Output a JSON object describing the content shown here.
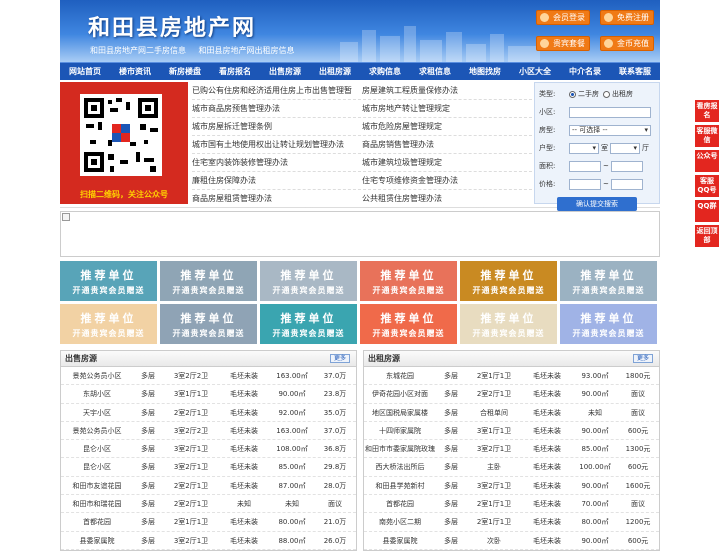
{
  "header": {
    "title": "和田县房地产网",
    "subtitle_1": "和田县房地产网二手房信息",
    "subtitle_2": "和田县房地产网出租房信息",
    "buttons": [
      "会员登录",
      "免费注册",
      "贵宾套餐",
      "金币充值"
    ]
  },
  "nav": [
    "网站首页",
    "楼市资讯",
    "新房楼盘",
    "看房报名",
    "出售房源",
    "出租房源",
    "求购信息",
    "求租信息",
    "地图找房",
    "小区大全",
    "中介名录",
    "联系客服"
  ],
  "qr": {
    "caption": "扫描二维码，关注公众号"
  },
  "links": [
    [
      "已购公有住房和经济适用住房上市出售管理暂",
      "房屋建筑工程质量保修办法"
    ],
    [
      "城市商品房预售管理办法",
      "城市房地产转让管理规定"
    ],
    [
      "城市房屋拆迁管理条例",
      "城市危险房屋管理规定"
    ],
    [
      "城市国有土地使用权出让转让规划管理办法",
      "商品房销售管理办法"
    ],
    [
      "住宅室内装饰装修管理办法",
      "城市建筑垃圾管理规定"
    ],
    [
      "廉租住房保障办法",
      "住宅专项维修资金管理办法"
    ],
    [
      "商品房屋租赁管理办法",
      "公共租赁住房管理办法"
    ]
  ],
  "search": {
    "type_label": "类型:",
    "opt_sale": "二手房",
    "opt_rent": "出租房",
    "community_label": "小区:",
    "house_type_label": "房型:",
    "house_type_value": "-- 可选择 --",
    "layout_label": "户型:",
    "room_unit": "室",
    "hall_unit": "厅",
    "area_label": "面积:",
    "price_label": "价格:",
    "tilde": "~",
    "submit": "确认提交搜索"
  },
  "recommend": {
    "title": "推荐单位",
    "sub": "开通贵宾会员赠送",
    "colors": [
      "#58a4b8",
      "#8fa5b5",
      "#a9b8c5",
      "#e8725a",
      "#c98a22",
      "#9bb2c2",
      "#f2d2a4",
      "#8fa3b5",
      "#3aa5b0",
      "#f06a4a",
      "#e8dcc0",
      "#a0b3e6"
    ]
  },
  "sale": {
    "title": "出售房源",
    "more": "更多",
    "rows": [
      [
        "景苑公务员小区",
        "多层",
        "3室2厅2卫",
        "毛坯未装",
        "163.00㎡",
        "37.0万"
      ],
      [
        "东胡小区",
        "多层",
        "3室1厅1卫",
        "毛坯未装",
        "90.00㎡",
        "23.8万"
      ],
      [
        "天宇小区",
        "多层",
        "2室2厅1卫",
        "毛坯未装",
        "92.00㎡",
        "35.0万"
      ],
      [
        "景苑公务员小区",
        "多层",
        "3室2厅2卫",
        "毛坯未装",
        "163.00㎡",
        "37.0万"
      ],
      [
        "昆仑小区",
        "多层",
        "3室2厅1卫",
        "毛坯未装",
        "108.00㎡",
        "36.8万"
      ],
      [
        "昆仑小区",
        "多层",
        "3室2厅1卫",
        "毛坯未装",
        "85.00㎡",
        "29.8万"
      ],
      [
        "和田市友谊花园",
        "多层",
        "2室2厅1卫",
        "毛坯未装",
        "87.00㎡",
        "28.0万"
      ],
      [
        "和田市和瑞花园",
        "多层",
        "2室2厅1卫",
        "未知",
        "未知",
        "面议"
      ],
      [
        "首都花园",
        "多层",
        "2室1厅1卫",
        "毛坯未装",
        "80.00㎡",
        "21.0万"
      ],
      [
        "县委家属院",
        "多层",
        "3室2厅1卫",
        "毛坯未装",
        "88.00㎡",
        "26.0万"
      ]
    ]
  },
  "rent": {
    "title": "出租房源",
    "more": "更多",
    "rows": [
      [
        "东城花园",
        "多层",
        "2室1厅1卫",
        "毛坯未装",
        "93.00㎡",
        "1800元"
      ],
      [
        "伊奇花园小区对面",
        "多层",
        "2室2厅1卫",
        "毛坯未装",
        "90.00㎡",
        "面议"
      ],
      [
        "地区国税局家属楼",
        "多层",
        "合租单间",
        "毛坯未装",
        "未知",
        "面议"
      ],
      [
        "十四师家属院",
        "多层",
        "3室1厅1卫",
        "毛坯未装",
        "90.00㎡",
        "600元"
      ],
      [
        "和田市市委家属院玫瑰",
        "多层",
        "3室2厅1卫",
        "毛坯未装",
        "85.00㎡",
        "1300元"
      ],
      [
        "西大桥法出所后",
        "多层",
        "主卧",
        "毛坯未装",
        "100.00㎡",
        "600元"
      ],
      [
        "和田县学苑新村",
        "多层",
        "3室2厅1卫",
        "毛坯未装",
        "90.00㎡",
        "1600元"
      ],
      [
        "首都花园",
        "多层",
        "2室1厅1卫",
        "毛坯未装",
        "70.00㎡",
        "面议"
      ],
      [
        "南苑小区二期",
        "多层",
        "2室1厅1卫",
        "毛坯未装",
        "80.00㎡",
        "1200元"
      ],
      [
        "县委家属院",
        "多层",
        "次卧",
        "毛坯未装",
        "90.00㎡",
        "600元"
      ]
    ]
  },
  "float": [
    "看房报名",
    "客服微信",
    "公众号",
    "客服QQ号",
    "QQ群",
    "返回顶部"
  ]
}
